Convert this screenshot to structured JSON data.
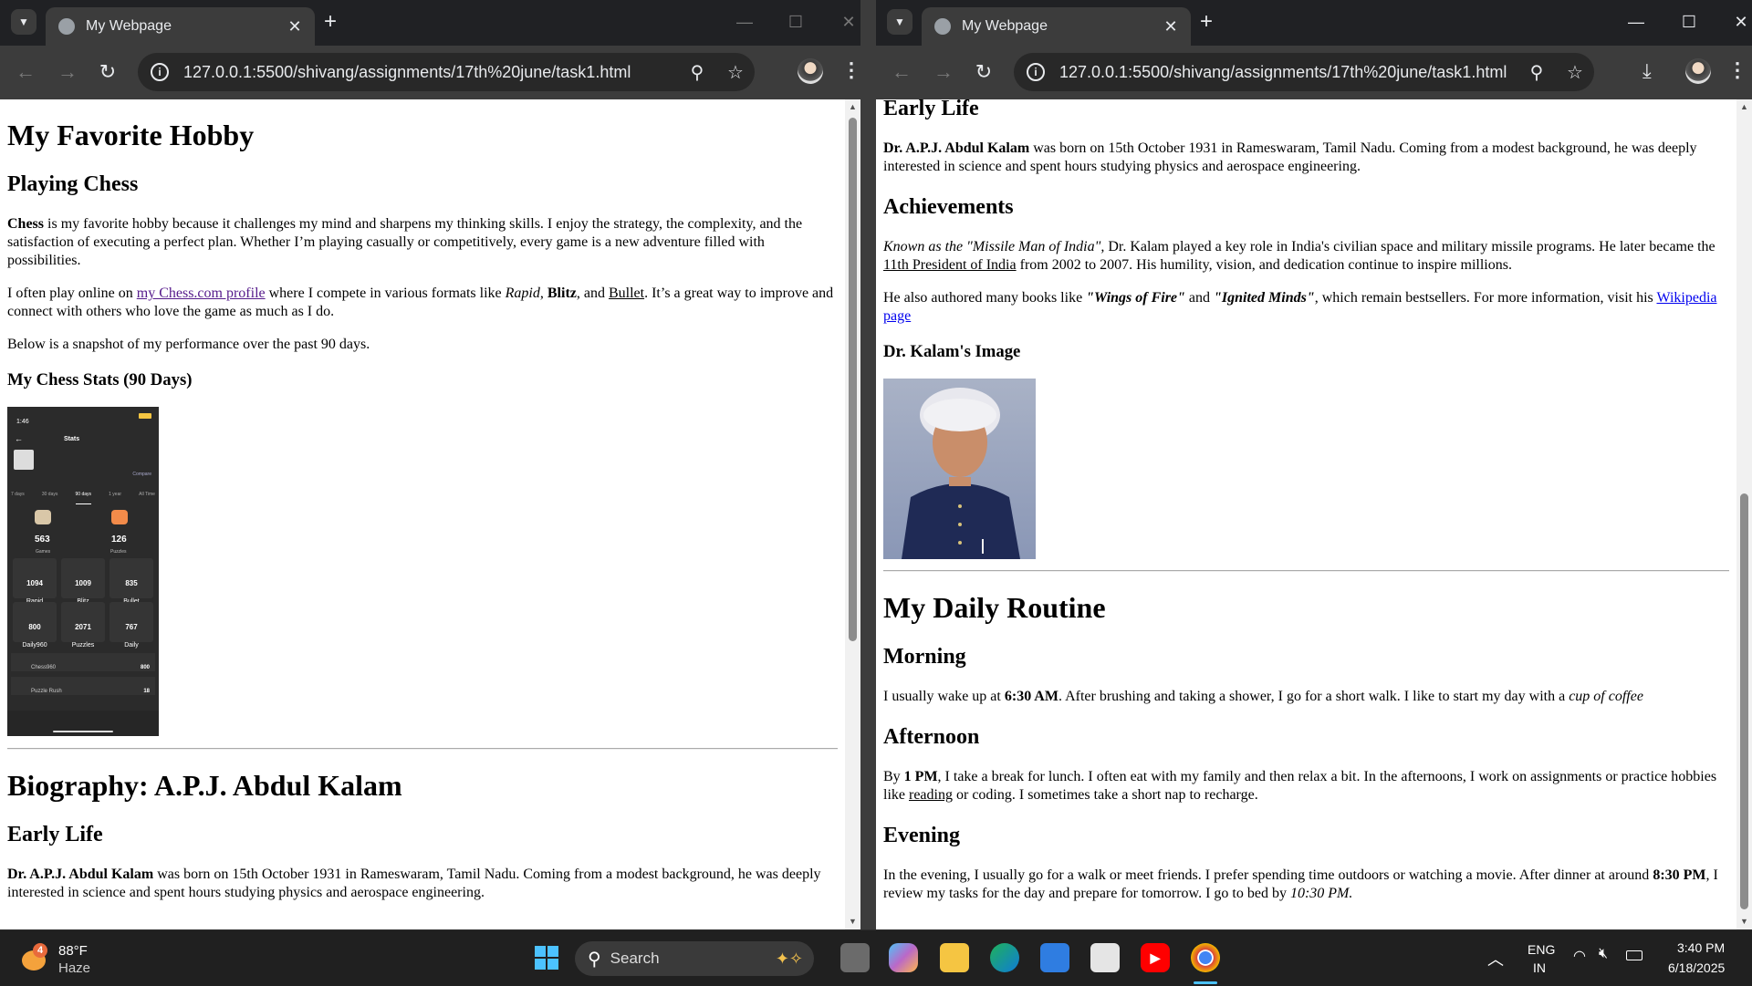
{
  "browser": {
    "tab_title": "My Webpage",
    "url": "127.0.0.1:5500/shivang/assignments/17th%20june/task1.html"
  },
  "left_page": {
    "h1": "My Favorite Hobby",
    "h2": "Playing Chess",
    "p1": {
      "bold": "Chess",
      "text": " is my favorite hobby because it challenges my mind and sharpens my thinking skills. I enjoy the strategy, the complexity, and the satisfaction of executing a perfect plan. Whether I’m playing casually or competitively, every game is a new adventure filled with possibilities."
    },
    "p2": {
      "t1": "I often play online on ",
      "link": "my Chess.com profile",
      "t2": " where I compete in various formats like ",
      "rapid": "Rapid",
      "t3": ", ",
      "blitz": "Blitz",
      "t4": ", and ",
      "bullet": "Bullet",
      "t5": ". It’s a great way to improve and connect with others who love the game as much as I do."
    },
    "p3": "Below is a snapshot of my performance over the past 90 days.",
    "h3_stats": "My Chess Stats (90 Days)",
    "phone": {
      "time": "1:46",
      "header": "Stats",
      "compare": "Compare",
      "ranges": [
        "7 days",
        "30 days",
        "90 days",
        "1 year",
        "All Time"
      ],
      "games_value": "563",
      "games_label": "Games",
      "puzzles_value": "126",
      "puzzles_label": "Puzzles",
      "stats": [
        {
          "value": "1094",
          "label": "Rapid"
        },
        {
          "value": "1009",
          "label": "Blitz"
        },
        {
          "value": "835",
          "label": "Bullet"
        },
        {
          "value": "800",
          "label": "Daily960"
        },
        {
          "value": "2071",
          "label": "Puzzles"
        },
        {
          "value": "767",
          "label": "Daily"
        }
      ],
      "chess960_label": "Chess960",
      "chess960_value": "800",
      "rush_label": "Puzzle Rush",
      "rush_value": "18"
    },
    "bio_h1": "Biography: A.P.J. Abdul Kalam",
    "early_h2": "Early Life",
    "early_p": {
      "bold": "Dr. A.P.J. Abdul Kalam",
      "text": " was born on 15th October 1931 in Rameswaram, Tamil Nadu. Coming from a modest background, he was deeply interested in science and spent hours studying physics and aerospace engineering."
    }
  },
  "right_page": {
    "early_h2": "Early Life",
    "early_p": {
      "bold": "Dr. A.P.J. Abdul Kalam",
      "text": " was born on 15th October 1931 in Rameswaram, Tamil Nadu. Coming from a modest background, he was deeply interested in science and spent hours studying physics and aerospace engineering."
    },
    "achievements_h2": "Achievements",
    "ach_p1": {
      "italic": "Known as the \"Missile Man of India\",",
      "t1": " Dr. Kalam played a key role in India's civilian space and military missile programs. He later became the ",
      "underline": "11th President of India",
      "t2": " from 2002 to 2007. His humility, vision, and dedication continue to inspire millions."
    },
    "ach_p2": {
      "t1": "He also authored many books like ",
      "book1": "\"Wings of Fire\"",
      "t2": " and ",
      "book2": "\"Ignited Minds\"",
      "t3": ", which remain bestsellers. For more information, visit his ",
      "link": "Wikipedia page"
    },
    "image_h3": "Dr. Kalam's Image",
    "routine_h1": "My Daily Routine",
    "morning_h2": "Morning",
    "morning_p": {
      "t1": "I usually wake up at ",
      "bold": "6:30 AM",
      "t2": ". After brushing and taking a shower, I go for a short walk. I like to start my day with a ",
      "italic": "cup of coffee"
    },
    "afternoon_h2": "Afternoon",
    "afternoon_p": {
      "t1": "By ",
      "bold": "1 PM",
      "t2": ", I take a break for lunch. I often eat with my family and then relax a bit. In the afternoons, I work on assignments or practice hobbies like ",
      "underline": "reading",
      "t3": " or coding. I sometimes take a short nap to recharge."
    },
    "evening_h2": "Evening",
    "evening_p": {
      "t1": "In the evening, I usually go for a walk or meet friends. I prefer spending time outdoors or watching a movie. After dinner at around ",
      "bold": "8:30 PM",
      "t2": ", I review my tasks for the day and prepare for tomorrow. I go to bed by ",
      "italic": "10:30 PM."
    }
  },
  "taskbar": {
    "weather_badge": "4",
    "temperature": "88°F",
    "condition": "Haze",
    "search_label": "Search",
    "lang_top": "ENG",
    "lang_bottom": "IN",
    "time": "3:40 PM",
    "date": "6/18/2025"
  },
  "colors": {
    "chrome_dark": "#202124",
    "chrome_toolbar": "#3c3c3c",
    "link_visited": "#551a8b",
    "link": "#0000ee",
    "taskbar": "#202020"
  }
}
